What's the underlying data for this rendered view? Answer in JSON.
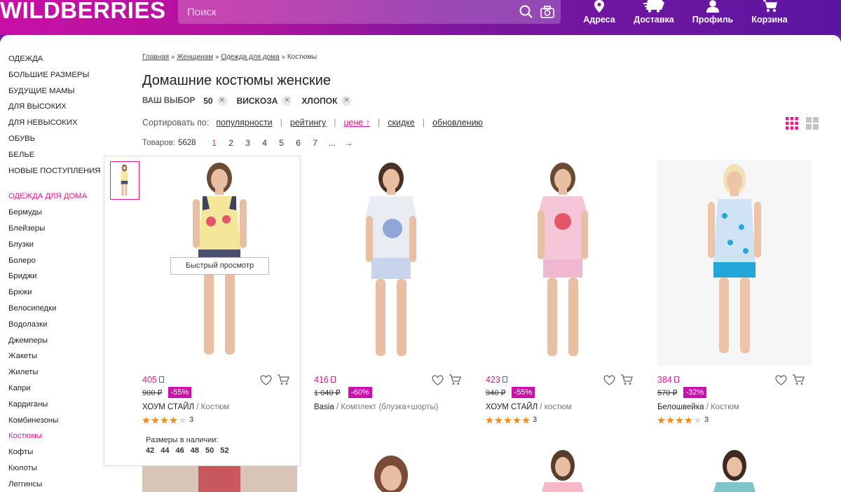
{
  "header": {
    "logo": "WILDBERRIES",
    "search_placeholder": "Поиск",
    "nav": [
      {
        "label": "Адреса",
        "icon": "map-pin-icon"
      },
      {
        "label": "Доставка",
        "icon": "delivery-truck-icon"
      },
      {
        "label": "Профиль",
        "icon": "profile-icon"
      },
      {
        "label": "Корзина",
        "icon": "cart-icon"
      }
    ]
  },
  "sidebar": {
    "top": [
      "ОДЕЖДА",
      "БОЛЬШИЕ РАЗМЕРЫ",
      "БУДУЩИЕ МАМЫ",
      "ДЛЯ ВЫСОКИХ",
      "ДЛЯ НЕВЫСОКИХ",
      "ОБУВЬ",
      "БЕЛЬЕ",
      "НОВЫЕ ПОСТУПЛЕНИЯ"
    ],
    "section": "ОДЕЖДА ДЛЯ ДОМА",
    "items": [
      "Бермуды",
      "Блейзеры",
      "Блузки",
      "Болеро",
      "Бриджи",
      "Брюки",
      "Велосипедки",
      "Водолазки",
      "Джемперы",
      "Жакеты",
      "Жилеты",
      "Капри",
      "Кардиганы",
      "Комбинезоны",
      "Костюмы",
      "Кофты",
      "Кюлоты",
      "Леггинсы"
    ],
    "active_item": "Костюмы"
  },
  "breadcrumb": {
    "items": [
      "Главная",
      "Женщинам",
      "Одежда для дома"
    ],
    "current": "Костюмы",
    "sep": "»"
  },
  "title": "Домашние костюмы женские",
  "filters": {
    "label": "ВАШ ВЫБОР",
    "chips": [
      "50",
      "ВИСКОЗА",
      "ХЛОПОК"
    ]
  },
  "sort": {
    "label": "Сортировать по:",
    "options": [
      "популярности",
      "рейтингу",
      "цене ↑",
      "скидке",
      "обновлению"
    ],
    "active": "цене ↑"
  },
  "count": {
    "label": "Товаров:",
    "value": "5628",
    "pages": [
      "1",
      "2",
      "3",
      "4",
      "5",
      "6",
      "7",
      "...",
      "→"
    ],
    "current_page": "1"
  },
  "products": [
    {
      "price": "405",
      "old_price": "900",
      "discount": "-55%",
      "brand": "ХОУМ СТАЙЛ",
      "desc": "Костюм",
      "stars": 4,
      "reviews": "3",
      "top_color": "#f4e79a",
      "bottom_color": "#4a4f6e"
    },
    {
      "price": "416",
      "old_price": "1 040",
      "discount": "-60%",
      "brand": "Basia",
      "desc": "Комплект (блузка+шорты)",
      "stars": 0,
      "reviews": "",
      "top_color": "#e9ecf3",
      "bottom_color": "#c8d3ec"
    },
    {
      "price": "423",
      "old_price": "940",
      "discount": "-55%",
      "brand": "ХОУМ СТАЙЛ",
      "desc": "костюм",
      "stars": 5,
      "reviews": "3",
      "top_color": "#f5c6d8",
      "bottom_color": "#f0b8d0"
    },
    {
      "price": "384",
      "old_price": "570",
      "discount": "-32%",
      "brand": "Белошвейка",
      "desc": "Костюм",
      "stars": 4,
      "reviews": "3",
      "top_color": "#cfe3f5",
      "bottom_color": "#24a6d8"
    }
  ],
  "hover_card": {
    "quick_view": "Быстрый просмотр",
    "sizes_label": "Размеры в наличии:",
    "sizes": [
      "42",
      "44",
      "46",
      "48",
      "50",
      "52"
    ]
  },
  "colors": {
    "accent": "#e5198e",
    "discount_bg": "#cb11ab",
    "star": "#f28a1c"
  }
}
